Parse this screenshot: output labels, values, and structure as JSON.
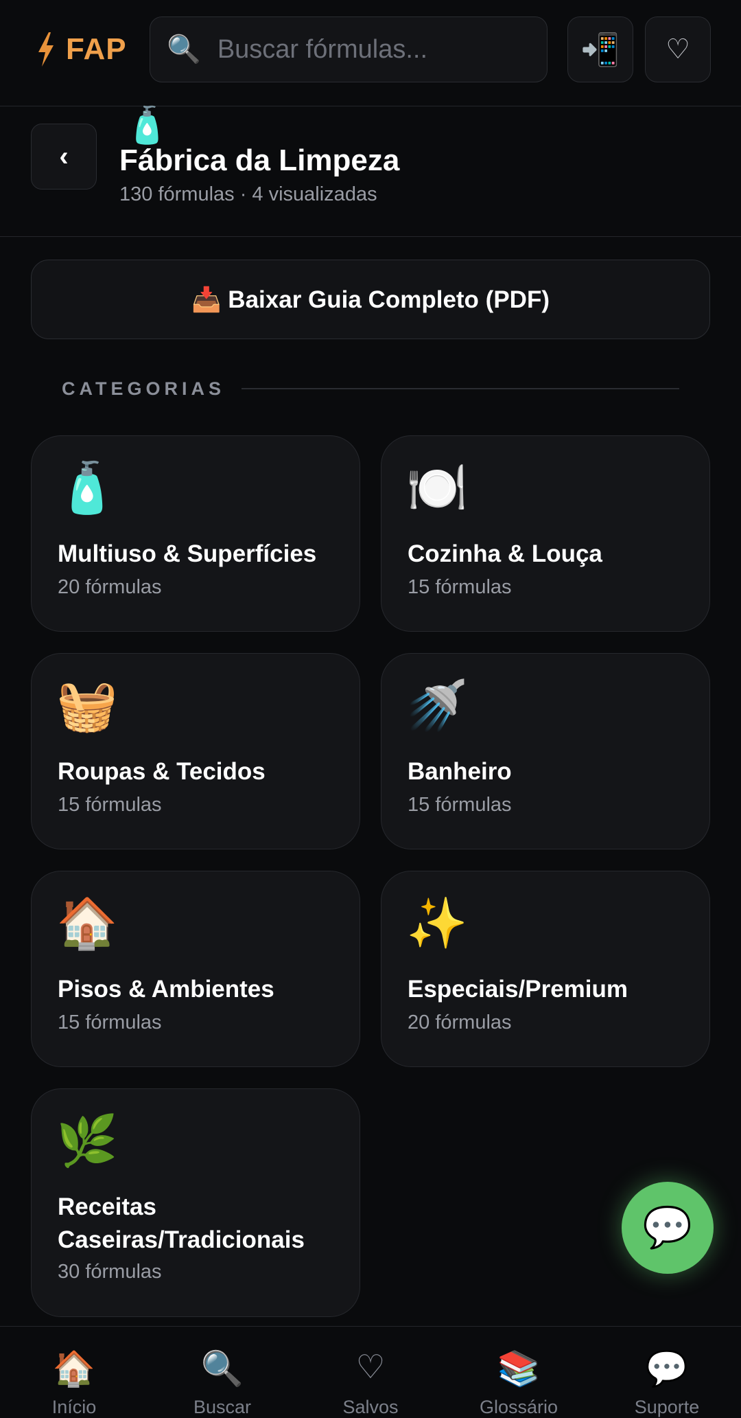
{
  "topbar": {
    "logo_text": "FAP",
    "search_placeholder": "Buscar fórmulas...",
    "search_icon": "🔍",
    "install_icon": "📲",
    "favorites_icon": "♡"
  },
  "header": {
    "back_icon": "‹",
    "emoji": "🧴",
    "title": "Fábrica da Limpeza",
    "subtitle": "130 fórmulas · 4 visualizadas"
  },
  "download_label": "📥 Baixar Guia Completo (PDF)",
  "section_label": "CATEGORIAS",
  "categories": [
    {
      "emoji": "🧴",
      "name": "Multiuso & Superfícies",
      "count": "20 fórmulas"
    },
    {
      "emoji": "🍽️",
      "name": "Cozinha & Louça",
      "count": "15 fórmulas"
    },
    {
      "emoji": "🧺",
      "name": "Roupas & Tecidos",
      "count": "15 fórmulas"
    },
    {
      "emoji": "🚿",
      "name": "Banheiro",
      "count": "15 fórmulas"
    },
    {
      "emoji": "🏠",
      "name": "Pisos & Ambientes",
      "count": "15 fórmulas"
    },
    {
      "emoji": "✨",
      "name": "Especiais/Premium",
      "count": "20 fórmulas"
    },
    {
      "emoji": "🌿",
      "name": "Receitas Caseiras/Tradicionais",
      "count": "30 fórmulas"
    }
  ],
  "fab_icon": "💬",
  "nav": [
    {
      "icon": "🏠",
      "label": "Início"
    },
    {
      "icon": "🔍",
      "label": "Buscar"
    },
    {
      "icon": "♡",
      "label": "Salvos"
    },
    {
      "icon": "📚",
      "label": "Glossário"
    },
    {
      "icon": "💬",
      "label": "Suporte"
    }
  ],
  "colors": {
    "background": "#0a0b0d",
    "card": "#141518",
    "accent_logo": "#f0a04b",
    "fab": "#5fc46a"
  }
}
